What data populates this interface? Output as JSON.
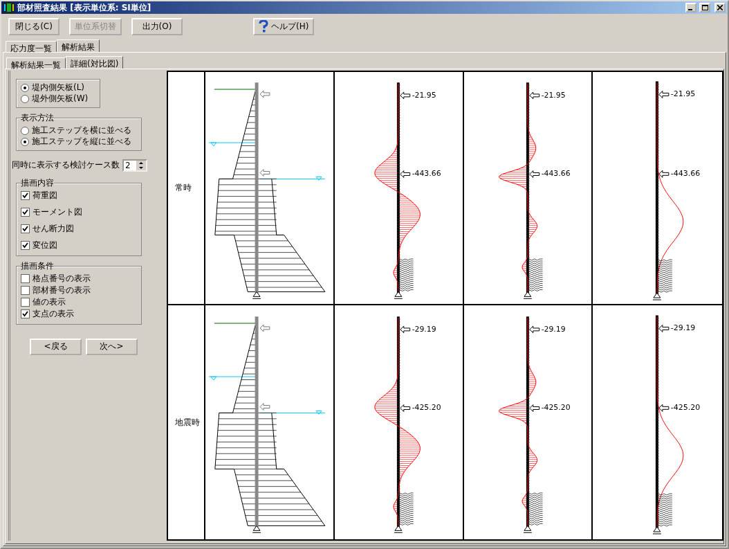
{
  "window": {
    "title": "部材照査結果 [表示単位系: SI単位]"
  },
  "toolbar": [
    {
      "label": "閉じる(C)",
      "disabled": false,
      "kind": "plain"
    },
    {
      "label": "単位系切替",
      "disabled": true,
      "kind": "plain"
    },
    {
      "label": "出力(O)",
      "disabled": false,
      "kind": "plain"
    },
    {
      "label": "ヘルプ(H)",
      "disabled": false,
      "kind": "help"
    }
  ],
  "tabs": [
    {
      "label": "応力度一覧",
      "selected": false
    },
    {
      "label": "解析結果",
      "selected": true
    }
  ],
  "subtabs": [
    {
      "label": "解析結果一覧",
      "selected": false
    },
    {
      "label": "詳細(対比図)",
      "selected": true
    }
  ],
  "panel": {
    "sides": [
      {
        "label": "堤内側矢板(L)",
        "selected": true
      },
      {
        "label": "堤外側矢板(W)",
        "selected": false
      }
    ],
    "display_method": {
      "title": "表示方法",
      "options": [
        {
          "label": "施工ステップを横に並べる",
          "selected": false
        },
        {
          "label": "施工ステップを縦に並べる",
          "selected": true
        }
      ]
    },
    "case_count": {
      "label": "同時に表示する検討ケース数",
      "value": "2"
    },
    "draw_content": {
      "title": "描画内容",
      "items": [
        {
          "label": "荷重図",
          "checked": true
        },
        {
          "label": "モーメント図",
          "checked": true
        },
        {
          "label": "せん断力図",
          "checked": true
        },
        {
          "label": "変位図",
          "checked": true
        }
      ]
    },
    "draw_conditions": {
      "title": "描画条件",
      "items": [
        {
          "label": "格点番号の表示",
          "checked": false
        },
        {
          "label": "部材番号の表示",
          "checked": false
        },
        {
          "label": "値の表示",
          "checked": false
        },
        {
          "label": "支点の表示",
          "checked": true
        }
      ]
    },
    "nav": [
      "<戻る",
      "次へ>"
    ]
  },
  "rows": [
    {
      "label": "常時",
      "diagrams": [
        {
          "kind": "load"
        },
        {
          "kind": "moment",
          "values": [
            "-21.95",
            "-443.66"
          ]
        },
        {
          "kind": "shear",
          "values": [
            "-21.95",
            "-443.66"
          ]
        },
        {
          "kind": "displacement",
          "values": [
            "-21.95",
            "-443.66"
          ]
        }
      ]
    },
    {
      "label": "地震時",
      "diagrams": [
        {
          "kind": "load"
        },
        {
          "kind": "moment",
          "values": [
            "-29.19",
            "-425.20"
          ]
        },
        {
          "kind": "shear",
          "values": [
            "-29.19",
            "-425.20"
          ]
        },
        {
          "kind": "displacement",
          "values": [
            "-29.19",
            "-425.20"
          ]
        }
      ]
    }
  ]
}
